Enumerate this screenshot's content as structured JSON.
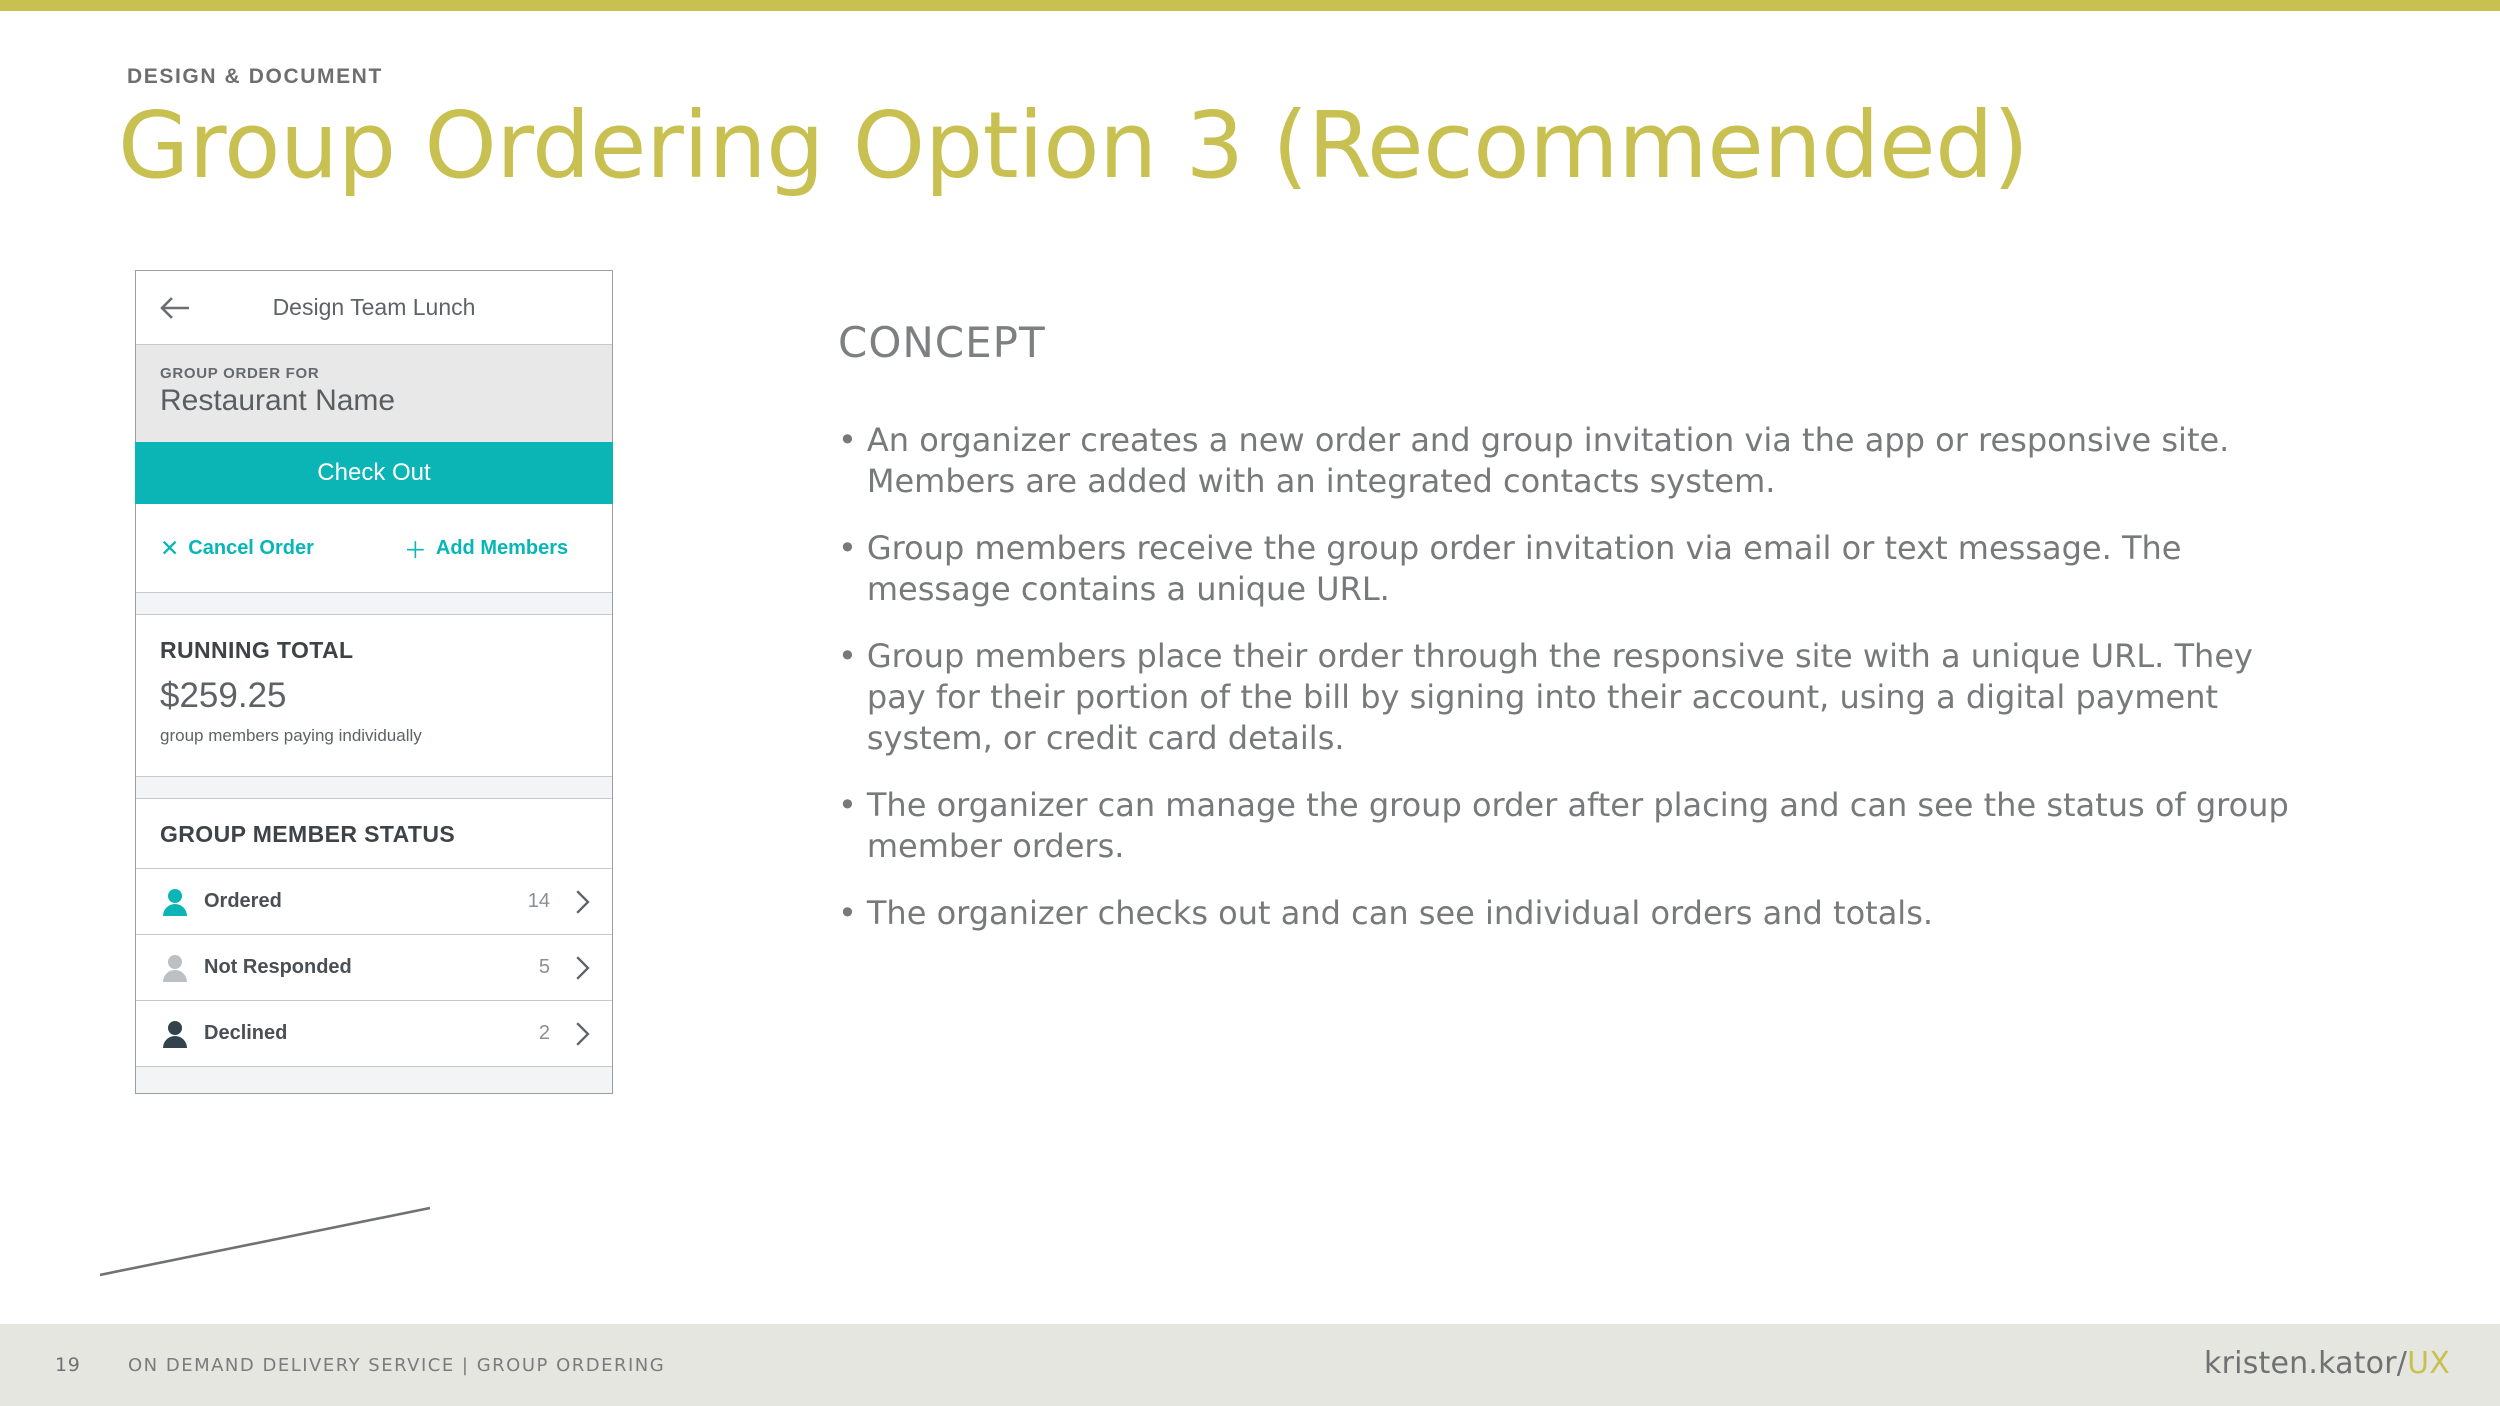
{
  "slide": {
    "eyebrow": "DESIGN & DOCUMENT",
    "title": "Group Ordering Option 3 (Recommended)",
    "accent_color": "#c9c052",
    "teal_color": "#0bb5b5"
  },
  "phone": {
    "nav": {
      "back_icon": "back-arrow-icon",
      "title": "Design Team Lunch"
    },
    "order_for": {
      "label": "GROUP ORDER FOR",
      "value": "Restaurant Name"
    },
    "checkout_label": "Check Out",
    "actions": [
      {
        "glyph": "✕",
        "label": "Cancel Order",
        "icon": "close-icon"
      },
      {
        "glyph": "＋",
        "label": "Add Members",
        "icon": "plus-icon"
      }
    ],
    "running_total": {
      "label": "RUNNING TOTAL",
      "amount": "$259.25",
      "note": "group members paying individually"
    },
    "member_status": {
      "header": "GROUP MEMBER STATUS",
      "rows": [
        {
          "label": "Ordered",
          "count": "14",
          "color": "#0bb5b5"
        },
        {
          "label": "Not Responded",
          "count": "5",
          "color": "#bcc0c4"
        },
        {
          "label": "Declined",
          "count": "2",
          "color": "#33434e"
        }
      ]
    }
  },
  "concept": {
    "heading": "CONCEPT",
    "bullet_glyph": "•",
    "bullets": [
      "An organizer creates a new order and group invitation via the app or responsive site. Members are added with an integrated contacts system.",
      "Group members receive the group order invitation via email or text message. The message contains a unique URL.",
      "Group members place their order through the responsive site with a unique URL. They pay for their portion of the bill by signing into their account, using a digital payment system, or credit card details.",
      "The organizer can manage the group order after placing and can see the status of group member orders.",
      "The organizer checks out and can see individual orders and totals."
    ]
  },
  "footer": {
    "page_number": "19",
    "text": "ON DEMAND DELIVERY SERVICE | GROUP ORDERING",
    "brand_main": "kristen.kator/",
    "brand_accent": "UX"
  }
}
